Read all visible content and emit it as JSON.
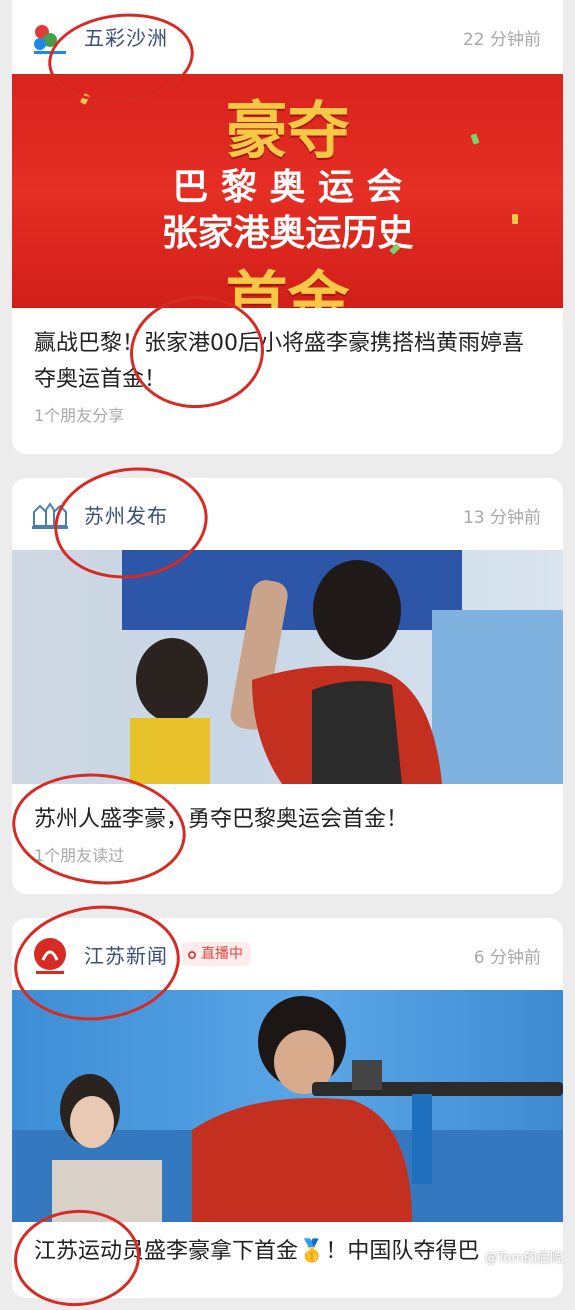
{
  "cards": [
    {
      "source": "五彩沙洲",
      "time": "22 分钟前",
      "poster": {
        "line1": "豪夺",
        "line2": "巴 黎 奥 运 会",
        "line3": "张家港奥运历史",
        "line4": "首金"
      },
      "title": "赢战巴黎！张家港00后小将盛李豪携搭档黄雨婷喜夺奥运首金！",
      "social": "1个朋友分享"
    },
    {
      "source": "苏州发布",
      "time": "13 分钟前",
      "title": "苏州人盛李豪，勇夺巴黎奥运会首金！",
      "social": "1个朋友读过"
    },
    {
      "source": "江苏新闻",
      "live_badge": "直播中",
      "time": "6 分钟前",
      "title": "江苏运动员盛李豪拿下首金🥇！中国队夺得巴"
    }
  ],
  "watermark": "@Tom的后院",
  "colors": {
    "accent_red": "#d62b24",
    "source_blue": "#3a4f7a",
    "poster_gold": "#f7c845"
  }
}
